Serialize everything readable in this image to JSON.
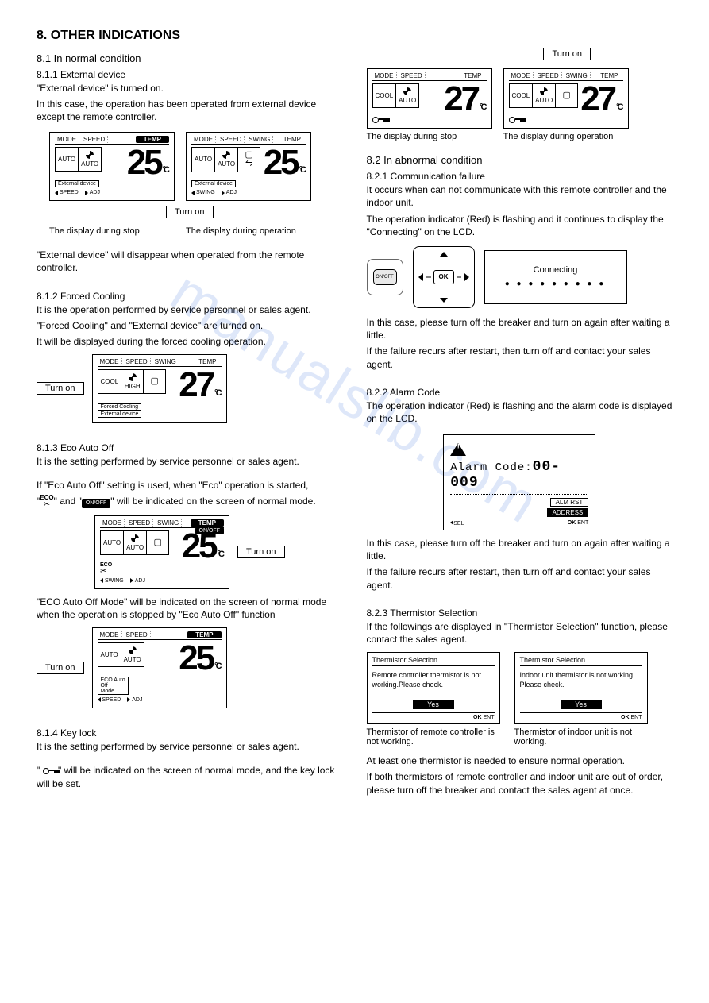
{
  "watermark": "manualslib.com",
  "heading": "8.  OTHER INDICATIONS",
  "s81": {
    "title": "8.1    In normal condition",
    "s811": {
      "title": "8.1.1     External device",
      "p1": "\"External device\" is turned on.",
      "p2": "In this case, the operation has been operated from external device except the remote controller.",
      "lcd_a": {
        "head_mode": "MODE",
        "head_speed": "SPEED",
        "head_temp": "TEMP",
        "mode": "AUTO",
        "speed": "AUTO",
        "num": "25",
        "tag": "External device",
        "foot_l": "SPEED",
        "foot_r": "ADJ"
      },
      "lcd_b": {
        "head_mode": "MODE",
        "head_speed": "SPEED",
        "head_swing": "SWING",
        "head_temp": "TEMP",
        "mode": "AUTO",
        "speed": "AUTO",
        "num": "25",
        "tag": "External device",
        "foot_l": "SWING",
        "foot_r": "ADJ"
      },
      "turn_on": "Turn on",
      "cap_a": "The display during stop",
      "cap_b": "The display during operation",
      "p3": "\"External device\" will disappear when operated from the remote controller."
    },
    "s812": {
      "title": "8.1.2    Forced Cooling",
      "p1": "It is the operation performed by service personnel or sales agent.",
      "p2": "\"Forced Cooling\" and \"External device\" are turned on.",
      "p3": "It will be displayed during the forced cooling operation.",
      "turn_on": "Turn on",
      "lcd": {
        "head_mode": "MODE",
        "head_speed": "SPEED",
        "head_swing": "SWING",
        "head_temp": "TEMP",
        "mode": "COOL",
        "speed": "HIGH",
        "num": "27",
        "tag1": "Forced Cooling",
        "tag2": "External device"
      }
    },
    "s813": {
      "title": "8.1.3    Eco Auto Off",
      "p1": "It is the setting performed by service personnel or sales agent.",
      "p2a": "If \"Eco Auto Off\" setting is used, when \"Eco\" operation is started,",
      "p2b": "\" and \"",
      "p2c": "\" will be indicated on the screen of normal mode.",
      "eco_label": "ECO",
      "onoff_chip": "ON/OFF",
      "turn_on": "Turn on",
      "lcd1": {
        "head_mode": "MODE",
        "head_speed": "SPEED",
        "head_swing": "SWING",
        "head_temp": "TEMP",
        "mode": "AUTO",
        "speed": "AUTO",
        "num": "25",
        "eco": "ECO",
        "foot_l": "SWING",
        "foot_r": "ADJ"
      },
      "p3": "\"ECO Auto Off Mode\" will be indicated on the screen of normal mode when the operation is stopped by \"Eco Auto Off\" function",
      "lcd2": {
        "head_mode": "MODE",
        "head_speed": "SPEED",
        "head_temp": "TEMP",
        "mode": "AUTO",
        "speed": "AUTO",
        "num": "25",
        "tag": "ECO Auto\nOff\nMode",
        "foot_l": "SPEED",
        "foot_r": "ADJ"
      }
    },
    "s814": {
      "title": "8.1.4  Key lock",
      "p1": "It is the setting performed by service personnel or sales agent.",
      "p2a": "\"",
      "p2b": "\" will be indicated on the screen of normal mode, and the key lock will be set."
    },
    "right_fig": {
      "turn_on": "Turn on",
      "lcd_a": {
        "head_mode": "MODE",
        "head_speed": "SPEED",
        "head_temp": "TEMP",
        "mode": "COOL",
        "speed": "AUTO",
        "num": "27"
      },
      "lcd_b": {
        "head_mode": "MODE",
        "head_speed": "SPEED",
        "head_swing": "SWING",
        "head_temp": "TEMP",
        "mode": "COOL",
        "speed": "AUTO",
        "num": "27"
      },
      "cap_a": "The display during stop",
      "cap_b": "The display during operation"
    }
  },
  "s82": {
    "title": "8.2    In abnormal condition",
    "s821": {
      "title": "8.2.1    Communication failure",
      "p1": "It occurs when can not communicate with this remote controller and the indoor unit.",
      "p2": "The operation indicator (Red) is flashing and it continues to display the \"Connecting\" on the LCD.",
      "onoff": "ON/OFF",
      "ok": "OK",
      "connecting": "Connecting",
      "dots": "● ● ● ● ● ● ● ● ●",
      "p3": "In this case, please turn off the breaker and turn on again after waiting a little.",
      "p4": "If the failure recurs after restart, then turn off and contact your sales agent."
    },
    "s822": {
      "title": "8.2.2    Alarm Code",
      "p1": "The operation indicator (Red) is flashing and the alarm code is displayed on the LCD.",
      "alarm_label": "Alarm Code:",
      "alarm_code": "00-009",
      "btn1": "ALM RST",
      "btn2": "ADDRESS",
      "foot_l": "SEL",
      "foot_r": "ENT",
      "p2": "In this case, please turn off the breaker and turn on again after waiting a little.",
      "p3": "If the failure recurs after restart, then turn off and contact your sales agent."
    },
    "s823": {
      "title": "8.2.3    Thermistor Selection",
      "p1": "If the followings are displayed in \"Thermistor Selection\" function, please contact the sales agent.",
      "box_a": {
        "hd": "Thermistor Selection",
        "msg": "Remote controller thermistor is not working.Please check.",
        "yes": "Yes",
        "ft": "ENT"
      },
      "box_b": {
        "hd": "Thermistor Selection",
        "msg": "Indoor unit thermistor is not working. Please check.",
        "yes": "Yes",
        "ft": "ENT"
      },
      "cap_a": "Thermistor of remote controller is not working.",
      "cap_b": "Thermistor of indoor unit is not working.",
      "p2": "At least one thermistor is needed to ensure normal operation.",
      "p3": "If both thermistors of remote controller and indoor unit are out of order, please turn off the breaker and contact the sales agent at once."
    }
  }
}
